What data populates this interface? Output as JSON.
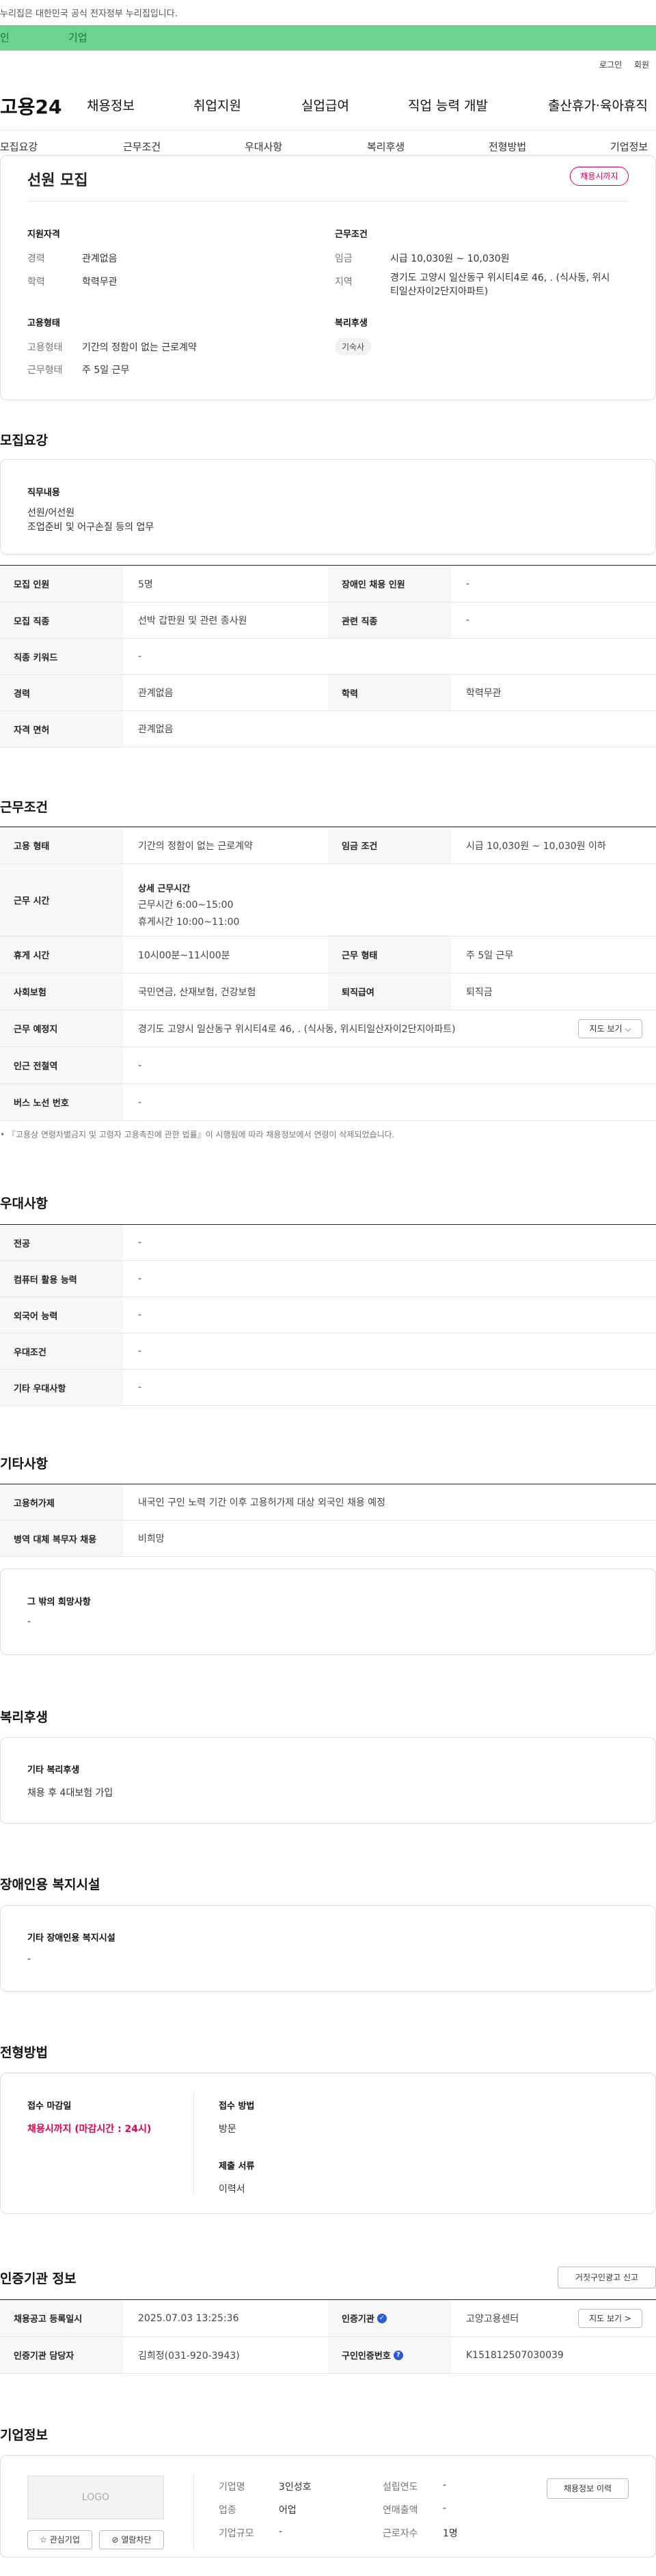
{
  "top_notice": "누리집은 대한민국 공식 전자정부 누리집입니다.",
  "user_tabs": [
    "인",
    "기업"
  ],
  "util": [
    "로그인",
    "회원"
  ],
  "logo": "고용24",
  "gnb": [
    "채용정보",
    "취업지원",
    "실업급여",
    "직업 능력 개발",
    "출산휴가·육아휴직"
  ],
  "subnav": [
    "모집요강",
    "근무조건",
    "우대사항",
    "복리후생",
    "전형방법",
    "기업정보"
  ],
  "title": "선원 모집",
  "deadline_badge": "채용시까지",
  "summary": {
    "qual_h": "지원자격",
    "career_k": "경력",
    "career_v": "관계없음",
    "edu_k": "학력",
    "edu_v": "학력무관",
    "cond_h": "근무조건",
    "wage_k": "임금",
    "wage_v": "시급 10,030원 ~ 10,030원",
    "area_k": "지역",
    "area_v1": "경기도 고양시 일산동구 위시티4로 46, . (식사동, 위시",
    "area_v2": "티일산자이2단지아파트)",
    "emp_h": "고용형태",
    "emptype_k": "고용형태",
    "emptype_v": "기간의 정함이 없는 근로계약",
    "days_k": "근무형태",
    "days_v": "주 5일 근무",
    "welfare_h": "복리후생",
    "welfare_tag": "기숙사"
  },
  "recruit": {
    "h": "모집요강",
    "duty_h": "직무내용",
    "duty_v1": "선원/어선원",
    "duty_v2": "조업준비 및 어구손질 등의 업무",
    "rows": [
      [
        "모집 인원",
        "5명",
        "장애인 채용 인원",
        "-"
      ],
      [
        "모집 직종",
        "선박 갑판원 및 관련 종사원",
        "관련 직종",
        "-"
      ],
      [
        "직종 키워드",
        "-"
      ],
      [
        "경력",
        "관계없음",
        "학력",
        "학력무관"
      ],
      [
        "자격 면허",
        "관계없음"
      ]
    ]
  },
  "work": {
    "h": "근무조건",
    "r1": [
      "고용 형태",
      "기간의 정함이 없는 근로계약",
      "임금 조건",
      "시급 10,030원 ~ 10,030원 이하"
    ],
    "r2": [
      "근무 시간",
      "상세 근무시간",
      "근무시간 6:00~15:00",
      "휴게시간 10:00~11:00"
    ],
    "r3": [
      "휴게 시간",
      "10시00분~11시00분",
      "근무 형태",
      "주 5일 근무"
    ],
    "r4": [
      "사회보험",
      "국민연금, 산재보험, 건강보험",
      "퇴직급여",
      "퇴직금"
    ],
    "r5": [
      "근무 예정지",
      "경기도 고양시 일산동구 위시티4로 46, . (식사동, 위시티일산자이2단지아파트)",
      "지도 보기 ⌵"
    ],
    "r6": [
      "인근 전철역",
      "-"
    ],
    "r7": [
      "버스 노선 번호",
      "-"
    ],
    "note": "• 『고용상 연령차별금지 및 고령자 고용촉진에 관한 법률』이 시행됨에 따라 채용정보에서 연령이 삭제되었습니다."
  },
  "pref": {
    "h": "우대사항",
    "rows": [
      [
        "전공",
        "-"
      ],
      [
        "컴퓨터 활용 능력",
        "-"
      ],
      [
        "외국어 능력",
        "-"
      ],
      [
        "우대조건",
        "-"
      ],
      [
        "기타 우대사항",
        "-"
      ]
    ]
  },
  "etc": {
    "h": "기타사항",
    "rows": [
      [
        "고용허가제",
        "내국인 구인 노력 기간 이후 고용허가제 대상 외국인 채용 예정"
      ],
      [
        "병역 대체 복무자 채용",
        "비희망"
      ]
    ],
    "other_h": "그 밖의 희망사항",
    "other_v": "-"
  },
  "welfare": {
    "h": "복리후생",
    "sub": "기타 복리후생",
    "v": "채용 후 4대보험 가입"
  },
  "disab": {
    "h": "장애인용 복지시설",
    "sub": "기타 장애인용 복지시설",
    "v": "-"
  },
  "screen": {
    "h": "전형방법",
    "deadline_k": "접수 마감일",
    "deadline_v": "채용시까지 (마감시간 : 24시)",
    "method_k": "접수 방법",
    "method_v": "방문",
    "docs_k": "제출 서류",
    "docs_v": "이력서"
  },
  "cert": {
    "h": "인증기관 정보",
    "report_btn": "거짓구인광고 신고",
    "r1": [
      "채용공고 등록일시",
      "2025.07.03 13:25:36",
      "인증기관",
      "고양고용센터",
      "지도 보기 >"
    ],
    "r2": [
      "인증기관 담당자",
      "김희정(031-920-3943)",
      "구인인증번호",
      "K151812507030039"
    ]
  },
  "company": {
    "h": "기업정보",
    "logo": "LOGO",
    "fav_btn": "☆ 관심기업",
    "block_btn": "⊘ 열람차단",
    "history_btn": "채용정보 이력",
    "rows": [
      [
        "기업명",
        "3인성호",
        "설립연도",
        "-"
      ],
      [
        "업종",
        "어업",
        "연매출액",
        "-"
      ],
      [
        "기업규모",
        "-",
        "근로자수",
        "1명"
      ]
    ]
  },
  "colors": {
    "accent": "#6dd191",
    "badge": "#e5004f"
  }
}
